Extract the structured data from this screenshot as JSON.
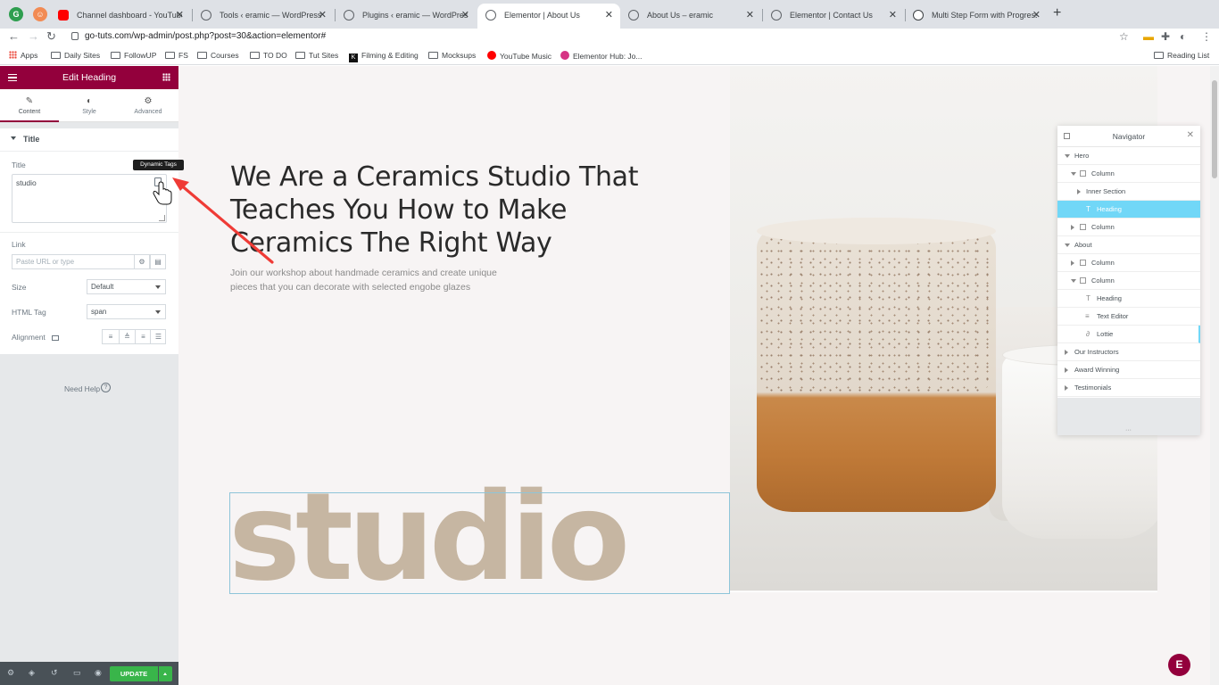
{
  "browser": {
    "tabs": [
      {
        "title": "Channel dashboard - YouTube",
        "favicon": "youtube-icon"
      },
      {
        "title": "Tools ‹ eramic — WordPress",
        "favicon": "globe-icon"
      },
      {
        "title": "Plugins ‹ eramic — WordPress",
        "favicon": "globe-icon"
      },
      {
        "title": "Elementor | About Us",
        "favicon": "globe-icon",
        "active": true
      },
      {
        "title": "About Us – eramic",
        "favicon": "globe-icon"
      },
      {
        "title": "Elementor | Contact Us",
        "favicon": "globe-icon"
      },
      {
        "title": "Multi Step Form with Progress",
        "favicon": "webflow-icon"
      }
    ],
    "url": "go-tuts.com/wp-admin/post.php?post=30&action=elementor#",
    "bookmarks": [
      "Apps",
      "Daily Sites",
      "FollowUP",
      "FS",
      "Courses",
      "TO DO",
      "Tut Sites",
      "Filming & Editing",
      "Mocksups",
      "YouTube Music",
      "Elementor Hub: Jo..."
    ],
    "reading_list": "Reading List"
  },
  "panel": {
    "title": "Edit Heading",
    "tabs": [
      "Content",
      "Style",
      "Advanced"
    ],
    "section_title": "Title",
    "title_label": "Title",
    "title_value": "studio",
    "link_label": "Link",
    "link_placeholder": "Paste URL or type",
    "size_label": "Size",
    "size_value": "Default",
    "html_tag_label": "HTML Tag",
    "html_tag_value": "span",
    "alignment_label": "Alignment",
    "need_help": "Need Help",
    "update_label": "UPDATE",
    "tooltip": "Dynamic Tags",
    "accent": "#93003c"
  },
  "canvas": {
    "heading": "We Are a Ceramics Studio That Teaches You How to Make Ceramics The Right Way",
    "subtext": "Join our workshop about handmade ceramics and create unique pieces that you can decorate with selected engobe glazes",
    "big_word": "studio"
  },
  "navigator": {
    "title": "Navigator",
    "items": [
      "Hero",
      "Column",
      "Inner Section",
      "Heading",
      "Column",
      "About",
      "Column",
      "Column",
      "Heading",
      "Text Editor",
      "Lottie",
      "Our Instructors",
      "Award Winning",
      "Testimonials"
    ]
  }
}
